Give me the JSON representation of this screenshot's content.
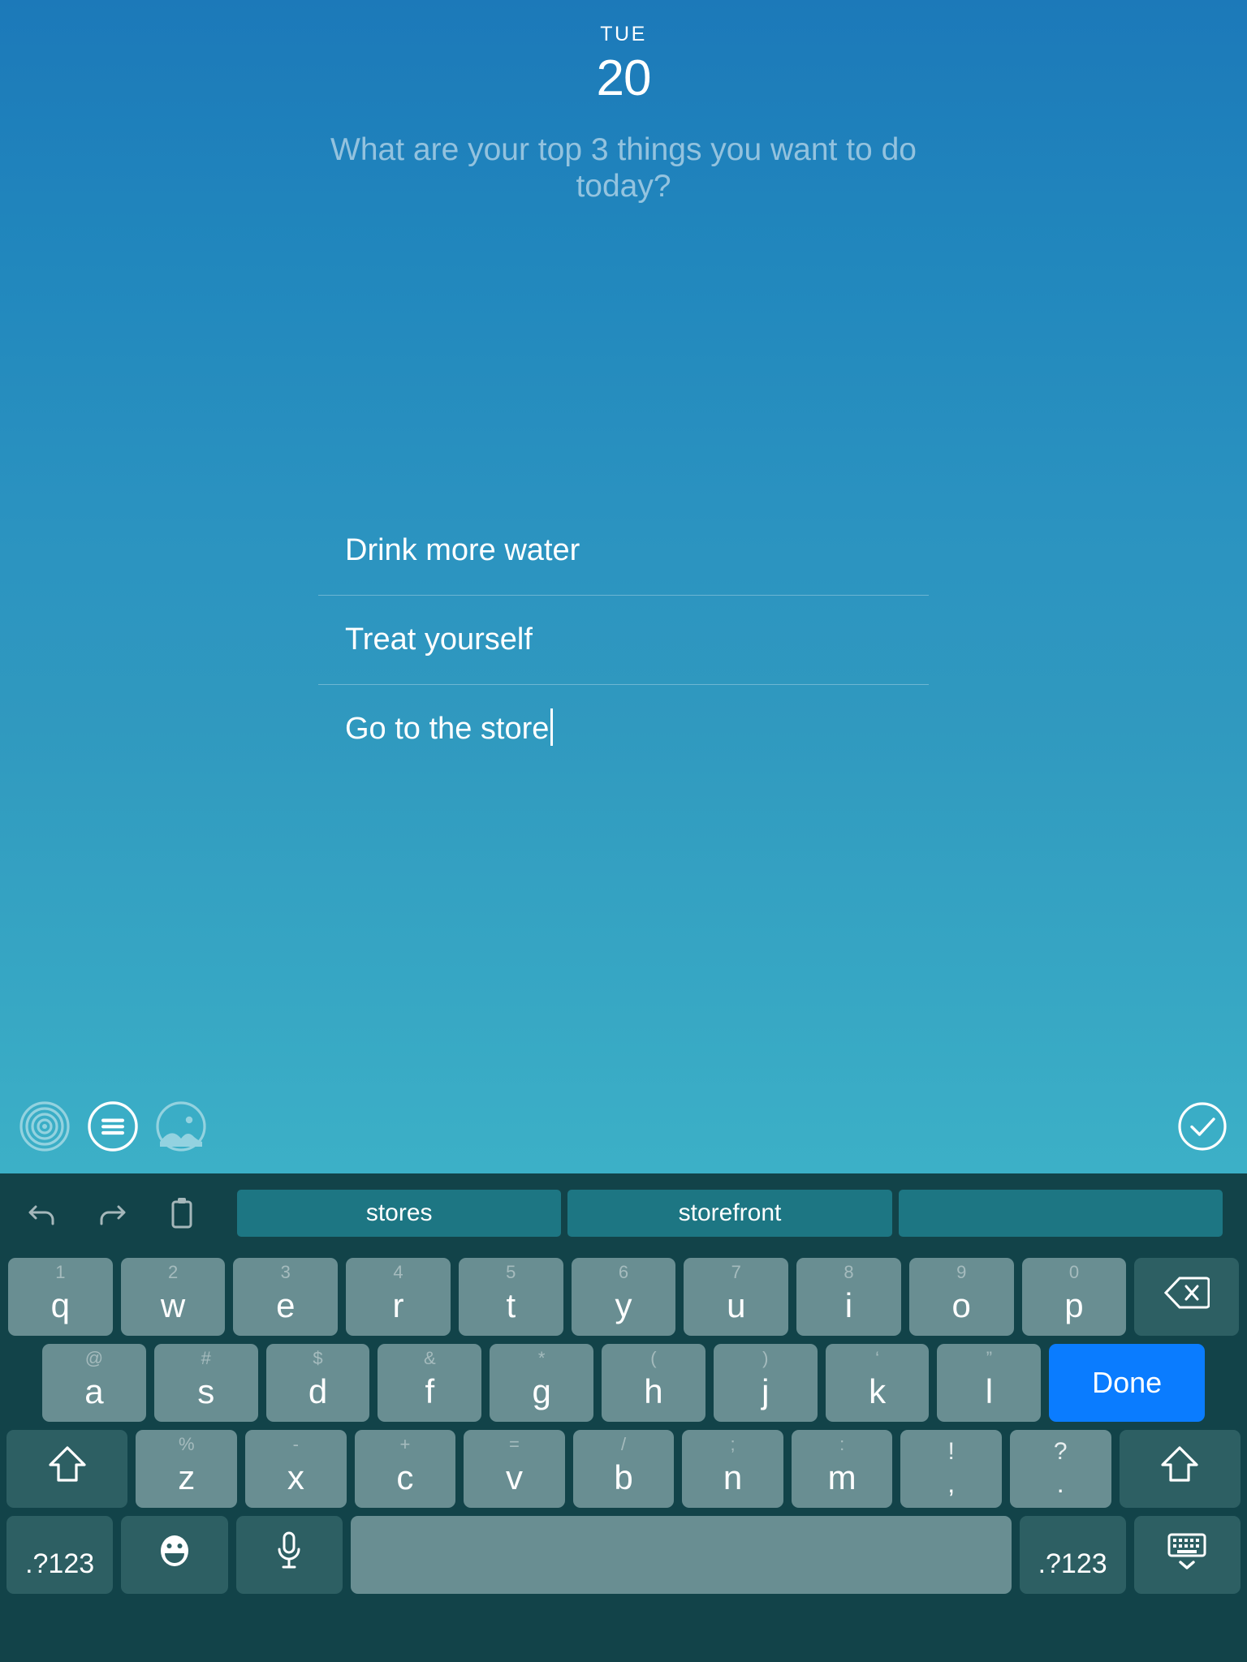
{
  "header": {
    "weekday": "TUE",
    "day": "20"
  },
  "prompt": "What are your top 3 things you want to do today?",
  "entries": [
    {
      "text": "Drink more water",
      "has_caret": false
    },
    {
      "text": "Treat yourself",
      "has_caret": false
    },
    {
      "text": "Go to the store",
      "has_caret": true
    }
  ],
  "note_toolbar": {
    "items": [
      {
        "name": "target-icon",
        "active": false
      },
      {
        "name": "list-icon",
        "active": true
      },
      {
        "name": "photo-icon",
        "active": false
      }
    ],
    "confirm": {
      "name": "check-circle-icon"
    }
  },
  "keyboard": {
    "suggestion_icons": [
      "undo-icon",
      "redo-icon",
      "clipboard-icon"
    ],
    "suggestions": [
      "stores",
      "storefront",
      ""
    ],
    "row1": [
      {
        "sub": "1",
        "main": "q"
      },
      {
        "sub": "2",
        "main": "w"
      },
      {
        "sub": "3",
        "main": "e"
      },
      {
        "sub": "4",
        "main": "r"
      },
      {
        "sub": "5",
        "main": "t"
      },
      {
        "sub": "6",
        "main": "y"
      },
      {
        "sub": "7",
        "main": "u"
      },
      {
        "sub": "8",
        "main": "i"
      },
      {
        "sub": "9",
        "main": "o"
      },
      {
        "sub": "0",
        "main": "p"
      }
    ],
    "backspace_label": "backspace-icon",
    "row2": [
      {
        "sub": "@",
        "main": "a"
      },
      {
        "sub": "#",
        "main": "s"
      },
      {
        "sub": "$",
        "main": "d"
      },
      {
        "sub": "&",
        "main": "f"
      },
      {
        "sub": "*",
        "main": "g"
      },
      {
        "sub": "(",
        "main": "h"
      },
      {
        "sub": ")",
        "main": "j"
      },
      {
        "sub": "‘",
        "main": "k"
      },
      {
        "sub": "”",
        "main": "l"
      }
    ],
    "done_label": "Done",
    "row3": [
      {
        "sub": "%",
        "main": "z"
      },
      {
        "sub": "-",
        "main": "x"
      },
      {
        "sub": "+",
        "main": "c"
      },
      {
        "sub": "=",
        "main": "v"
      },
      {
        "sub": "/",
        "main": "b"
      },
      {
        "sub": ";",
        "main": "n"
      },
      {
        "sub": ":",
        "main": "m"
      },
      {
        "sub": "!",
        "main": ",",
        "punct": true
      },
      {
        "sub": "?",
        "main": ".",
        "punct": true
      }
    ],
    "shift_left_label": "shift-icon",
    "shift_right_label": "shift-icon",
    "row4": {
      "symbols_left": ".?123",
      "emoji": "emoji-icon",
      "mic": "microphone-icon",
      "space": "",
      "symbols_right": ".?123",
      "hide": "hide-keyboard-icon"
    }
  },
  "colors": {
    "note_top": "#1c79b9",
    "note_bottom": "#3cb0c7",
    "keyboard_bg": "#124349",
    "key_bg": "#698e92",
    "key_dark": "#2d5f63",
    "done_blue": "#0a7cff",
    "suggestion_bg": "#1d7683"
  }
}
